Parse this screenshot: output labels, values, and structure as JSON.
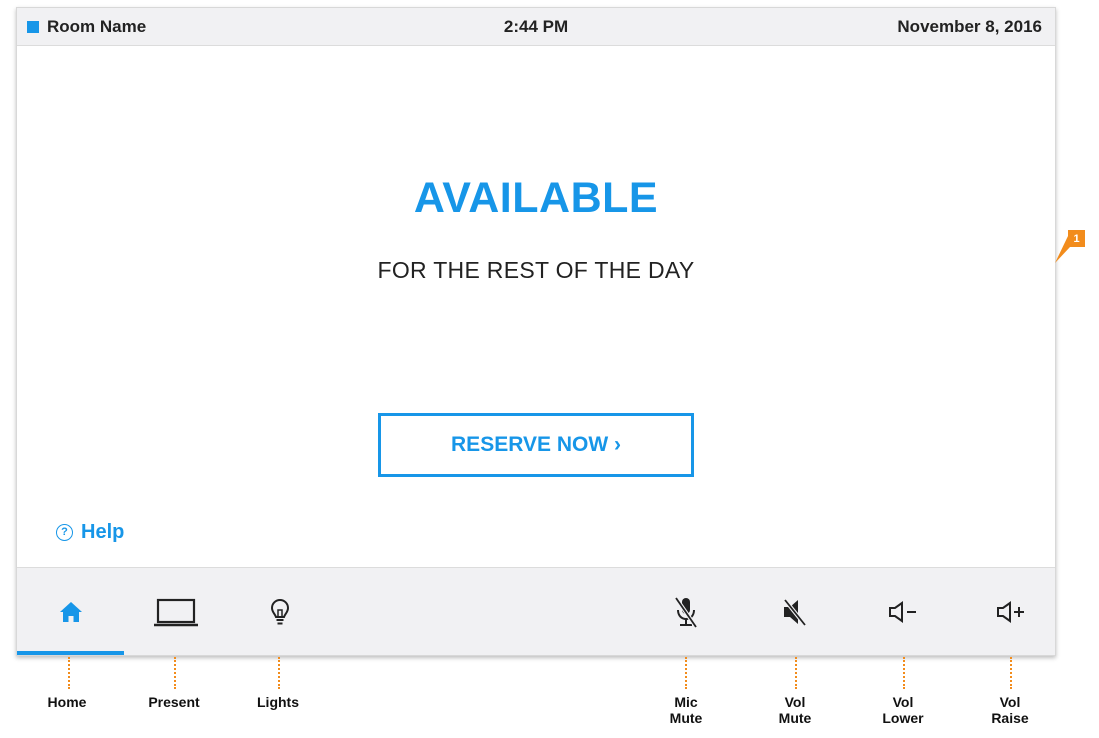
{
  "status_bar": {
    "room_name": "Room Name",
    "time": "2:44 PM",
    "date": "November 8, 2016"
  },
  "main": {
    "status": "AVAILABLE",
    "subtitle": "FOR THE REST OF THE DAY",
    "reserve_label": "RESERVE NOW ›",
    "help_icon": "?",
    "help_label": "Help"
  },
  "nav": {
    "active": "home",
    "buttons": [
      "home-icon",
      "laptop-icon",
      "lightbulb-icon",
      "mic-mute-icon",
      "speaker-mute-icon",
      "volume-down-icon",
      "volume-up-icon"
    ]
  },
  "callout": {
    "number": "1"
  },
  "annotations": {
    "home": "Home",
    "present": "Present",
    "lights": "Lights",
    "mic_mute_1": "Mic",
    "mic_mute_2": "Mute",
    "vol_mute_1": "Vol",
    "vol_mute_2": "Mute",
    "vol_lower_1": "Vol",
    "vol_lower_2": "Lower",
    "vol_raise_1": "Vol",
    "vol_raise_2": "Raise"
  },
  "colors": {
    "accent": "#1796e8",
    "callout": "#f28c1c",
    "bar_background": "#f1f1f3"
  }
}
